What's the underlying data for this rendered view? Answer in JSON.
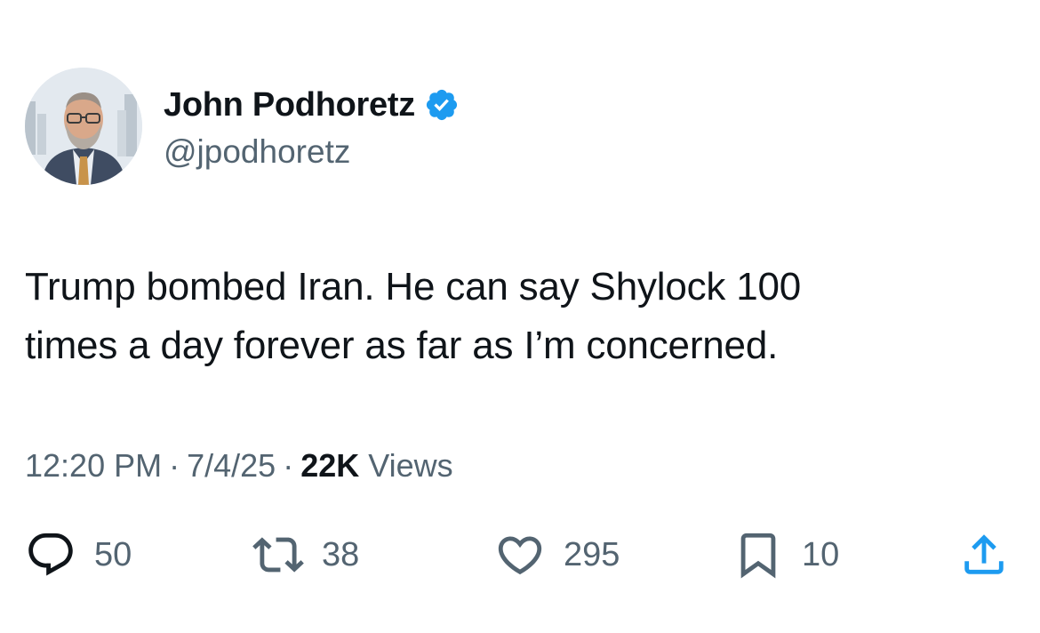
{
  "author": {
    "display_name": "John Podhoretz",
    "handle": "@jpodhoretz",
    "verified": true,
    "verified_color": "#1d9bf0"
  },
  "tweet": {
    "text_line1": "Trump bombed Iran. He can say Shylock 100",
    "text_line2": "times a day forever as far as I’m concerned."
  },
  "meta": {
    "time": "12:20 PM",
    "date": "7/4/25",
    "views_count": "22K",
    "views_label": "Views",
    "separator": "·"
  },
  "actions": {
    "replies": "50",
    "reposts": "38",
    "likes": "295",
    "bookmarks": "10"
  },
  "icons": {
    "reply": "speech-bubble-icon",
    "repost": "repost-arrows-icon",
    "like": "heart-icon",
    "bookmark": "bookmark-icon",
    "share": "share-upload-icon"
  },
  "colors": {
    "text": "#0f1419",
    "secondary": "#536471",
    "accent": "#1d9bf0"
  }
}
